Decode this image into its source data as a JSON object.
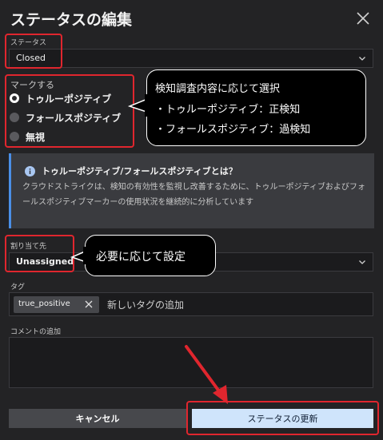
{
  "dialog": {
    "title": "ステータスの編集"
  },
  "status": {
    "label": "ステータス",
    "value": "Closed"
  },
  "mark": {
    "label": "マークする",
    "options": [
      {
        "label": "トゥルーポジティブ",
        "checked": true
      },
      {
        "label": "フォールスポジティブ",
        "checked": false
      },
      {
        "label": "無視",
        "checked": false
      }
    ]
  },
  "callouts": {
    "mark_note": {
      "line1": "検知調査内容に応じて選択",
      "line2": "・トゥルーポジティブ：正検知",
      "line3": "・フォールスポジティブ：過検知"
    },
    "assign_note": "必要に応じて設定"
  },
  "info": {
    "title": "トゥルーポジティブ/フォールスポジティブとは？",
    "body": "クラウドストライクは、検知の有効性を監視し改善するために、トゥルーポジティブおよびフォールスポジティブマーカーの使用状況を継続的に分析しています"
  },
  "assignee": {
    "label": "割り当て先",
    "value": "Unassigned"
  },
  "tags": {
    "label": "タグ",
    "chips": [
      "true_positive"
    ],
    "placeholder": "新しいタグの追加"
  },
  "comment": {
    "label": "コメントの追加",
    "value": ""
  },
  "buttons": {
    "cancel": "キャンセル",
    "update": "ステータスの更新"
  },
  "colors": {
    "background": "#232325",
    "annotation_red": "#e0262e",
    "info_accent": "#4a8fe7",
    "primary_button": "#cfe4fb"
  }
}
